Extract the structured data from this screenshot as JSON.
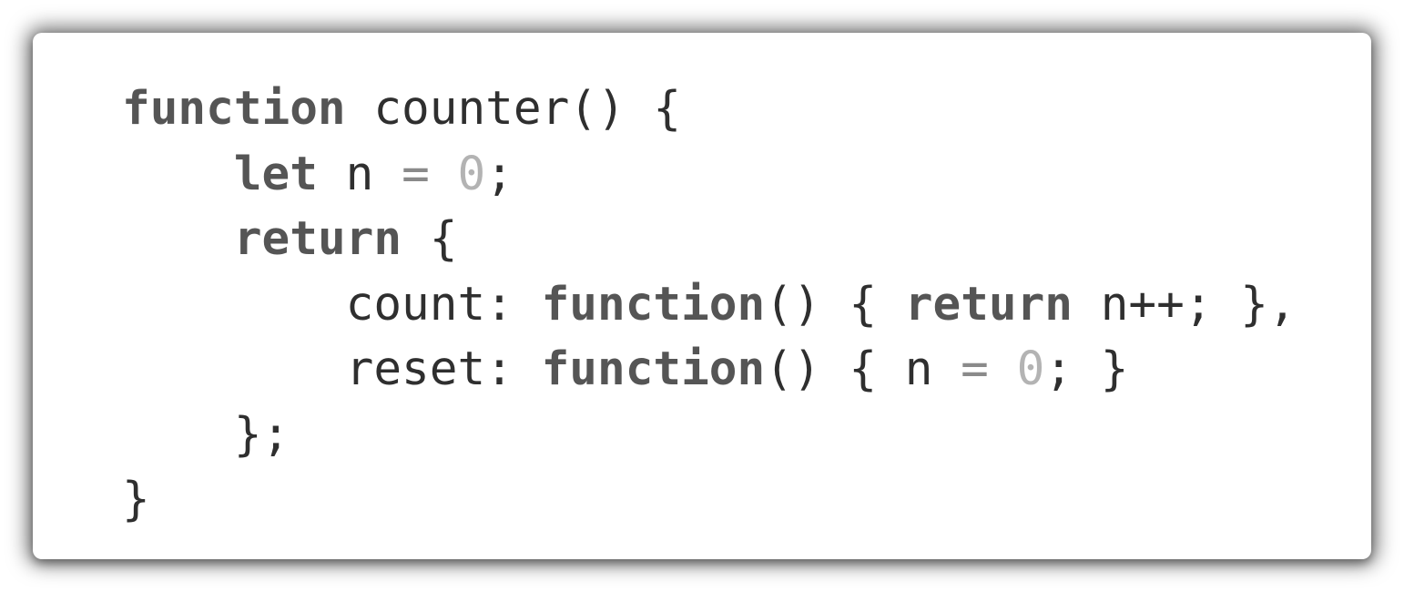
{
  "code_block": {
    "lines": [
      {
        "indent": "",
        "tokens": [
          {
            "t": "function",
            "k": "kw"
          },
          {
            "t": " counter() {",
            "k": "plain"
          }
        ]
      },
      {
        "indent": "    ",
        "tokens": [
          {
            "t": "let",
            "k": "kw"
          },
          {
            "t": " n ",
            "k": "plain"
          },
          {
            "t": "=",
            "k": "op"
          },
          {
            "t": " ",
            "k": "plain"
          },
          {
            "t": "0",
            "k": "num"
          },
          {
            "t": ";",
            "k": "plain"
          }
        ]
      },
      {
        "indent": "    ",
        "tokens": [
          {
            "t": "return",
            "k": "kw"
          },
          {
            "t": " {",
            "k": "plain"
          }
        ]
      },
      {
        "indent": "        ",
        "tokens": [
          {
            "t": "count: ",
            "k": "plain"
          },
          {
            "t": "function",
            "k": "kw"
          },
          {
            "t": "() { ",
            "k": "plain"
          },
          {
            "t": "return",
            "k": "kw"
          },
          {
            "t": " n++; },",
            "k": "plain"
          }
        ]
      },
      {
        "indent": "        ",
        "tokens": [
          {
            "t": "reset: ",
            "k": "plain"
          },
          {
            "t": "function",
            "k": "kw"
          },
          {
            "t": "() { n ",
            "k": "plain"
          },
          {
            "t": "=",
            "k": "op"
          },
          {
            "t": " ",
            "k": "plain"
          },
          {
            "t": "0",
            "k": "num"
          },
          {
            "t": "; }",
            "k": "plain"
          }
        ]
      },
      {
        "indent": "    ",
        "tokens": [
          {
            "t": "};",
            "k": "plain"
          }
        ]
      },
      {
        "indent": "",
        "tokens": [
          {
            "t": "}",
            "k": "plain"
          }
        ]
      }
    ],
    "colors": {
      "text": "#2f2f2f",
      "keyword": "#555555",
      "number": "#b3b3b3",
      "operator": "#8a8a8a",
      "background": "#ffffff"
    }
  }
}
